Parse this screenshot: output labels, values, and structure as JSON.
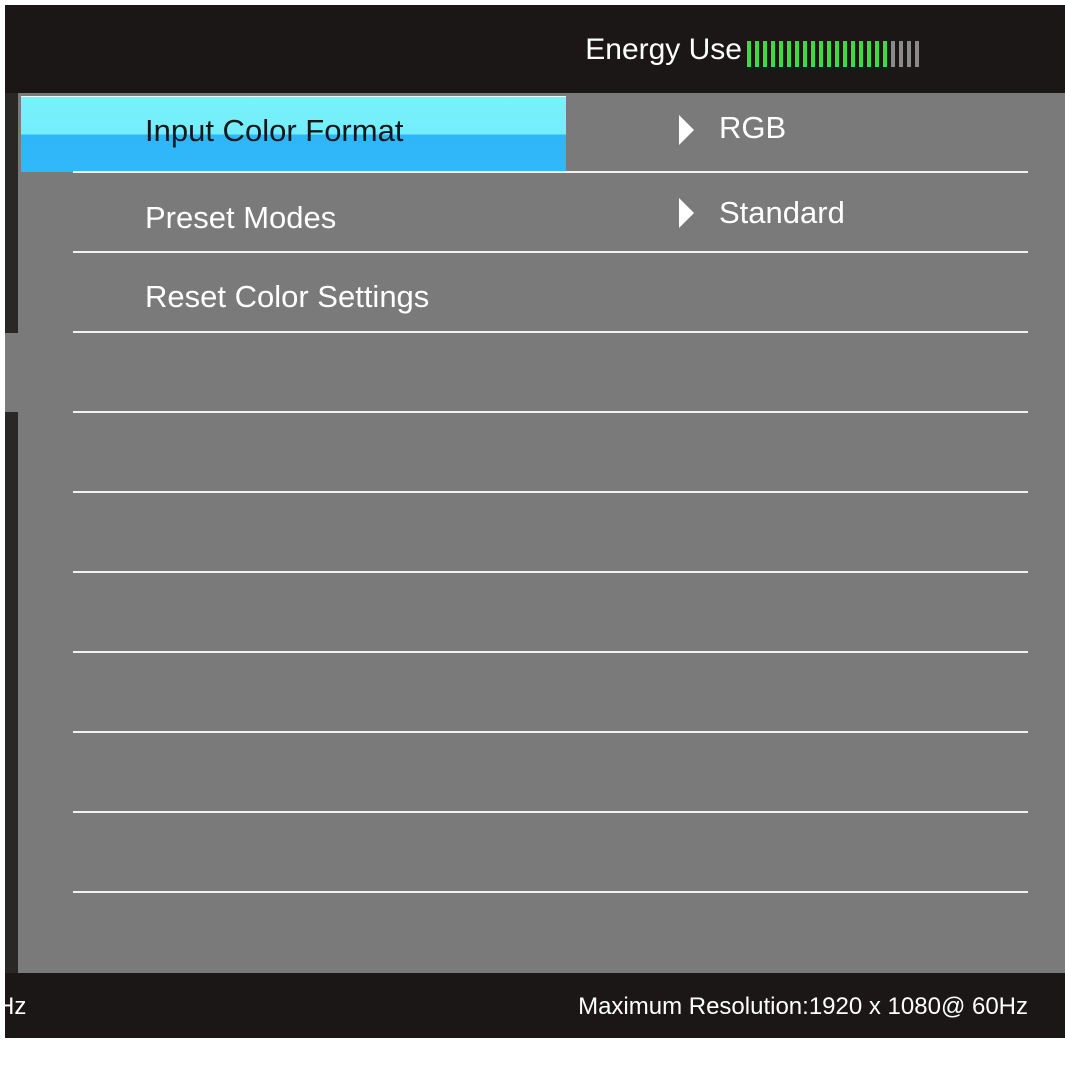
{
  "header": {
    "energy_label": "Energy Use",
    "energy_meter": {
      "segments_total": 22,
      "segments_active": 18,
      "active_color": "#3cd94a",
      "inactive_color": "#8a8a8a"
    }
  },
  "menu": {
    "items": [
      {
        "label": "Input Color Format",
        "value": "RGB",
        "has_submenu": true,
        "selected": true
      },
      {
        "label": "Preset Modes",
        "value": "Standard",
        "has_submenu": true,
        "selected": false
      },
      {
        "label": "Reset Color Settings",
        "value": "",
        "has_submenu": false,
        "selected": false
      },
      {
        "label": "",
        "value": ""
      },
      {
        "label": "",
        "value": ""
      },
      {
        "label": "",
        "value": ""
      },
      {
        "label": "",
        "value": ""
      },
      {
        "label": "",
        "value": ""
      },
      {
        "label": "",
        "value": ""
      },
      {
        "label": "",
        "value": ""
      }
    ],
    "highlight_color": "#2fb8fb"
  },
  "footer": {
    "left_text": "Hz",
    "right_text": "Maximum Resolution:1920 x 1080@ 60Hz"
  }
}
